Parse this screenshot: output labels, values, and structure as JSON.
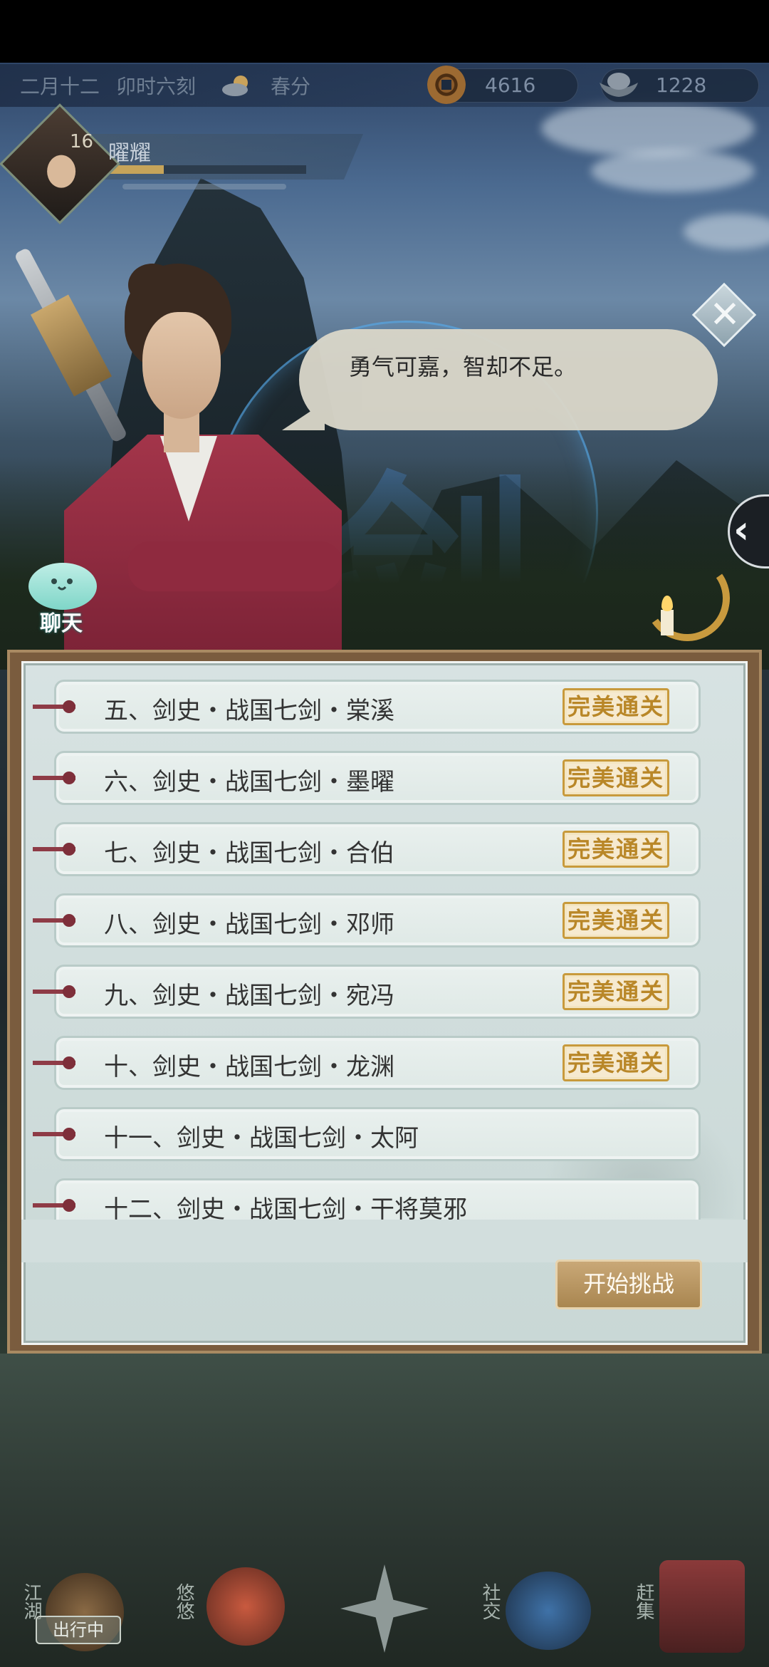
{
  "hud": {
    "date": "二月十二",
    "time": "卯时六刻",
    "solar_term": "春分",
    "copper_coins": "4616",
    "silver_ingots": "1228"
  },
  "player": {
    "level": "16",
    "name": "曜耀"
  },
  "dialog": {
    "speech": "勇气可嘉，智却不足。"
  },
  "sidebar": {
    "chat_label": "聊天"
  },
  "stages": [
    {
      "label": "五、剑史・战国七剑・棠溪",
      "seal": "完美通关"
    },
    {
      "label": "六、剑史・战国七剑・墨曜",
      "seal": "完美通关"
    },
    {
      "label": "七、剑史・战国七剑・合伯",
      "seal": "完美通关"
    },
    {
      "label": "八、剑史・战国七剑・邓师",
      "seal": "完美通关"
    },
    {
      "label": "九、剑史・战国七剑・宛冯",
      "seal": "完美通关"
    },
    {
      "label": "十、剑史・战国七剑・龙渊",
      "seal": "完美通关"
    },
    {
      "label": "十一、剑史・战国七剑・太阿",
      "seal": ""
    },
    {
      "label": "十二、剑史・战国七剑・干将莫邪",
      "seal": ""
    }
  ],
  "actions": {
    "start_challenge": "开始挑战"
  },
  "bottom_nav": {
    "jianghu": "江湖",
    "jianghu_status": "出行中",
    "youyou": "悠悠",
    "social": "社交",
    "market": "赶集"
  },
  "colors": {
    "seal_gold": "#c89a3c",
    "panel_bg": "#d7e2e2",
    "robe_red": "#a3354a"
  }
}
